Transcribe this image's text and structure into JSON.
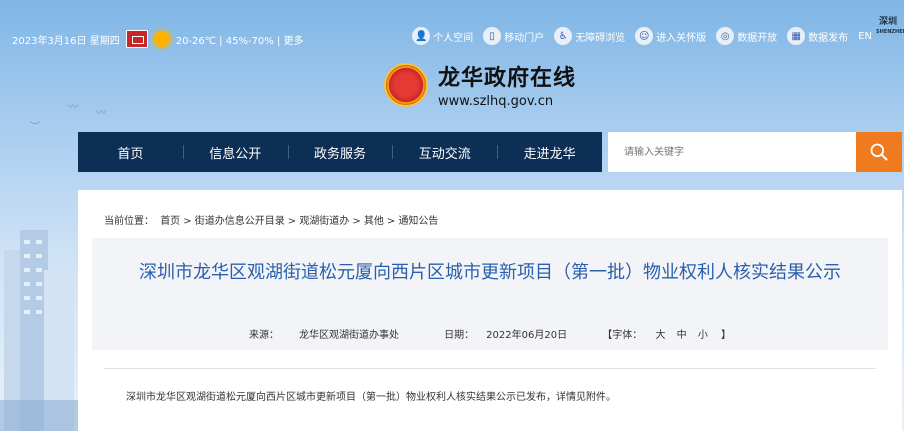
{
  "topbar": {
    "date": "2023年3月16日 星期四",
    "weather": "20-26℃ | 45%-70% | 更多",
    "links": [
      {
        "label": "个人空间",
        "icon": "person-icon"
      },
      {
        "label": "移动门户",
        "icon": "mobile-icon"
      },
      {
        "label": "无障碍浏览",
        "icon": "accessibility-icon"
      },
      {
        "label": "进入关怀版",
        "icon": "care-icon"
      },
      {
        "label": "数据开放",
        "icon": "data-open-icon"
      },
      {
        "label": "数据发布",
        "icon": "data-publish-icon"
      },
      {
        "label": "EN",
        "icon": ""
      }
    ],
    "shenzhen_logo": "深圳 SHENZHEN"
  },
  "header": {
    "site_title": "龙华政府在线",
    "site_url": "www.szlhq.gov.cn"
  },
  "nav": {
    "items": [
      "首页",
      "信息公开",
      "政务服务",
      "互动交流",
      "走进龙华"
    ]
  },
  "search": {
    "placeholder": "请输入关键字"
  },
  "breadcrumb": {
    "prefix": "当前位置：",
    "items": [
      "首页",
      "街道办信息公开目录",
      "观湖街道办",
      "其他",
      "通知公告"
    ]
  },
  "article": {
    "title": "深圳市龙华区观湖街道松元厦向西片区城市更新项目（第一批）物业权利人核实结果公示",
    "source_label": "来源：",
    "source": "龙华区观湖街道办事处",
    "date_label": "日期：",
    "date": "2022年06月20日",
    "font_label": "【字体：",
    "font_sizes": [
      "大",
      "中",
      "小"
    ],
    "font_close": "】",
    "body": "深圳市龙华区观湖街道松元厦向西片区城市更新项目（第一批）物业权利人核实结果公示已发布，详情见附件。"
  },
  "colors": {
    "nav_bg": "#0d2f55",
    "search_btn": "#f07b1e",
    "title_color": "#2a5fae"
  }
}
